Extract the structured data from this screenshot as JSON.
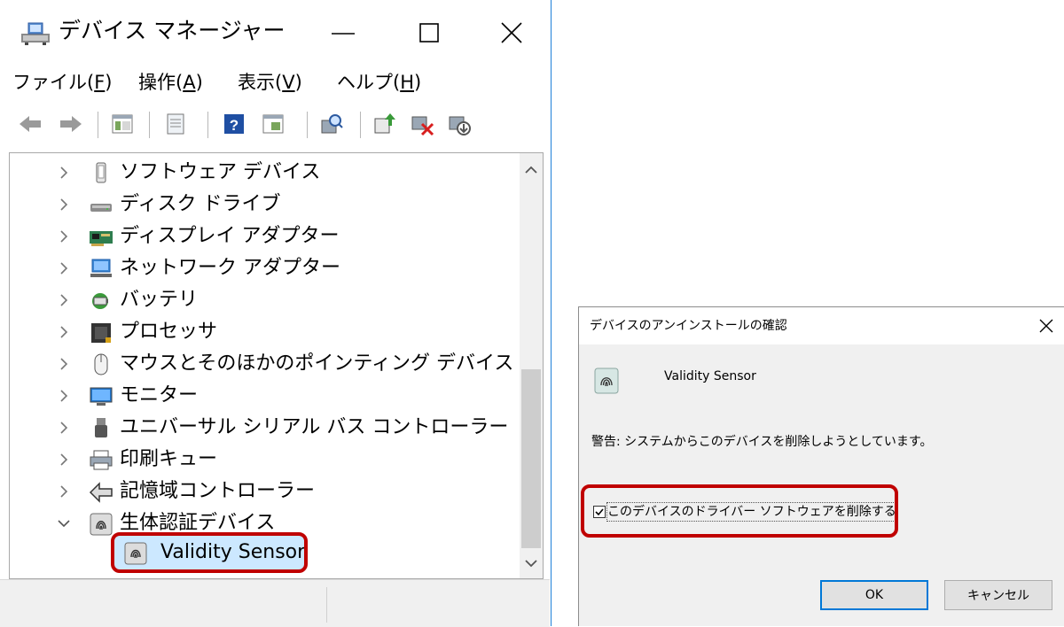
{
  "device_manager": {
    "title": "デバイス マネージャー",
    "window_controls": {
      "minimize": "minimize-icon",
      "maximize": "maximize-icon",
      "close": "close-icon"
    },
    "menu": {
      "file": {
        "text": "ファイル(",
        "key": "F",
        "end": ")"
      },
      "action": {
        "text": "操作(",
        "key": "A",
        "end": ")"
      },
      "view": {
        "text": "表示(",
        "key": "V",
        "end": ")"
      },
      "help": {
        "text": "ヘルプ(",
        "key": "H",
        "end": ")"
      }
    },
    "toolbar_icons": [
      "back-arrow-icon",
      "forward-arrow-icon",
      "properties-list-icon",
      "document-icon",
      "help-icon",
      "view-icon",
      "scan-hardware-icon",
      "update-driver-icon",
      "uninstall-device-icon",
      "disable-device-icon"
    ],
    "tree": [
      {
        "label": "ソフトウェア デバイス",
        "icon": "software-device-icon",
        "expanded": false
      },
      {
        "label": "ディスク ドライブ",
        "icon": "disk-drive-icon",
        "expanded": false
      },
      {
        "label": "ディスプレイ アダプター",
        "icon": "display-adapter-icon",
        "expanded": false
      },
      {
        "label": "ネットワーク アダプター",
        "icon": "network-adapter-icon",
        "expanded": false
      },
      {
        "label": "バッテリ",
        "icon": "battery-icon",
        "expanded": false
      },
      {
        "label": "プロセッサ",
        "icon": "processor-icon",
        "expanded": false
      },
      {
        "label": "マウスとそのほかのポインティング デバイス",
        "icon": "mouse-icon",
        "expanded": false
      },
      {
        "label": "モニター",
        "icon": "monitor-icon",
        "expanded": false
      },
      {
        "label": "ユニバーサル シリアル バス コントローラー",
        "icon": "usb-icon",
        "expanded": false
      },
      {
        "label": "印刷キュー",
        "icon": "printer-icon",
        "expanded": false
      },
      {
        "label": "記憶域コントローラー",
        "icon": "storage-controller-icon",
        "expanded": false
      },
      {
        "label": "生体認証デバイス",
        "icon": "fingerprint-icon",
        "expanded": true
      }
    ],
    "selected_child": {
      "label": "Validity Sensor",
      "icon": "fingerprint-icon"
    },
    "highlight_color": "#c00000",
    "selection_color": "#cce8ff"
  },
  "confirm_dialog": {
    "title": "デバイスのアンインストールの確認",
    "device_name": "Validity Sensor",
    "warning": "警告: システムからこのデバイスを削除しようとしています。",
    "checkbox_label": "このデバイスのドライバー ソフトウェアを削除する",
    "checkbox_checked": true,
    "ok_label": "OK",
    "cancel_label": "キャンセル",
    "accent_color": "#0078d7"
  }
}
